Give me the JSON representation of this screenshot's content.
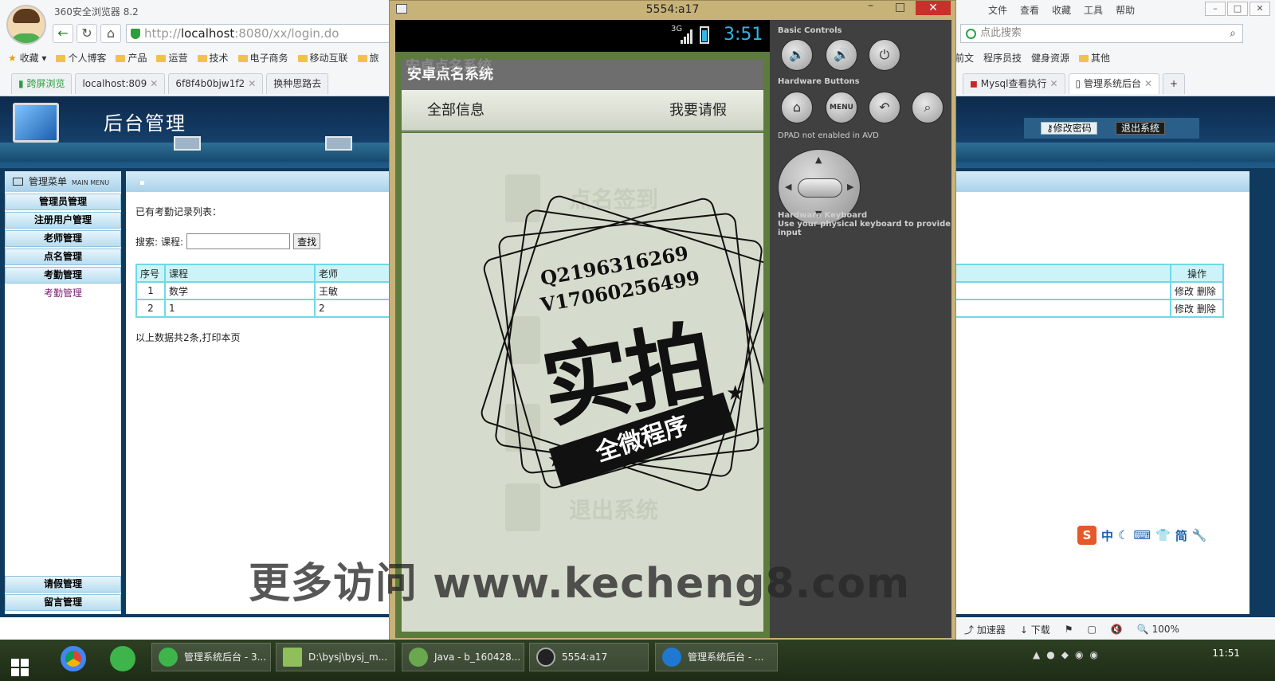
{
  "browser": {
    "title": "360安全浏览器 8.2",
    "url_scheme": "http://",
    "url_host": "localhost",
    "url_rest": ":8080/xx/login.do",
    "search_placeholder": "点此搜索",
    "menu": [
      "文件",
      "查看",
      "收藏",
      "工具",
      "帮助"
    ],
    "bookmarks_left": [
      "收藏",
      "个人博客",
      "产品",
      "运营",
      "技术",
      "电子商务",
      "移动互联",
      "旅"
    ],
    "bookmarks_right": [
      "前文",
      "程序员技",
      "健身资源",
      "其他"
    ],
    "tabs_left": [
      "跨屏浏览",
      "localhost:809",
      "6f8f4b0bjw1f2",
      "换种思路去"
    ],
    "tabs_right": [
      "Mysql查看执行",
      "管理系统后台"
    ],
    "status_items": [
      "加速器",
      "下载",
      "100%"
    ]
  },
  "admin": {
    "title": "后台管理",
    "change_password": "修改密码",
    "logout": "退出系统",
    "menu_title": "管理菜单",
    "menu_title_en": "MAIN MENU",
    "menu_items": [
      "管理员管理",
      "注册用户管理",
      "老师管理",
      "点名管理",
      "考勤管理"
    ],
    "submenu_active": "考勤管理",
    "menu_bottom": [
      "请假管理",
      "留言管理"
    ],
    "list_title": "已有考勤记录列表：",
    "search_label": "搜索:",
    "course_label": "课程:",
    "search_button": "查找",
    "columns": [
      "序号",
      "课程",
      "老师",
      "操作"
    ],
    "rows": [
      {
        "no": "1",
        "course": "数学",
        "teacher": "王敏",
        "ops": "修改 删除"
      },
      {
        "no": "2",
        "course": "1",
        "teacher": "2",
        "ops": "修改 删除"
      }
    ],
    "footer": "以上数据共2条,打印本页"
  },
  "ime": {
    "items": [
      "中",
      "简"
    ]
  },
  "emulator": {
    "window_title": "5554:a17",
    "network": "3G",
    "time": "3:51",
    "app_title": "安卓点名系统",
    "nav_left": "全部信息",
    "nav_right": "我要请假",
    "ghost_items": [
      "点名签到",
      "退出系统"
    ],
    "labels": {
      "basic": "Basic Controls",
      "hardware_buttons": "Hardware Buttons",
      "dpad": "DPAD not enabled in AVD",
      "keyboard": "Hardware Keyboard",
      "keyboard_note": "Use your physical keyboard to provide input"
    },
    "menu_button": "MENU"
  },
  "stamp": {
    "line1": "Q2196316269",
    "line2": "V17060256499",
    "big": "实拍",
    "ribbon": "全微程序"
  },
  "watermark": "更多访问 www.kecheng8.com",
  "taskbar": {
    "tasks": [
      "管理系统后台 - 3...",
      "D:\\bysj\\bysj_m...",
      "Java - b_160428...",
      "5554:a17",
      "管理系统后台 - ..."
    ],
    "time": "11:51"
  },
  "colors": {
    "admin_header": "#143e68",
    "table_border": "#6fd9e6",
    "emulator_frame": "#c7b278",
    "android_accent": "#33b5e5"
  }
}
